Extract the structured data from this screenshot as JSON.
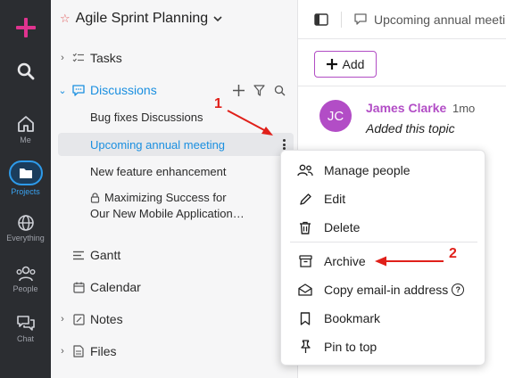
{
  "rail": {
    "items": [
      {
        "label": ""
      },
      {
        "label": ""
      },
      {
        "label": "Me"
      },
      {
        "label": "Projects"
      },
      {
        "label": "Everything"
      },
      {
        "label": "People"
      },
      {
        "label": "Chat"
      }
    ]
  },
  "sidebar": {
    "workspace_title": "Agile Sprint Planning",
    "tree": {
      "tasks": "Tasks",
      "discussions": "Discussions",
      "discussion_items": [
        "Bug fixes Discussions",
        "Upcoming annual meeting",
        "New feature enhancement",
        "Maximizing Success for",
        "Our New Mobile Application…"
      ],
      "gantt": "Gantt",
      "calendar": "Calendar",
      "notes": "Notes",
      "files": "Files"
    }
  },
  "main": {
    "tab_title": "Upcoming annual meeti",
    "add_label": "Add",
    "comment": {
      "avatar_initials": "JC",
      "author": "James Clarke",
      "time": "1mo",
      "text": "Added this topic"
    }
  },
  "context_menu": {
    "items": [
      "Manage people",
      "Edit",
      "Delete",
      "Archive",
      "Copy email-in address",
      "Bookmark",
      "Pin to top"
    ]
  },
  "annotations": {
    "step1": "1",
    "step2": "2"
  },
  "colors": {
    "accent_blue": "#1a8fe0",
    "brand_purple": "#b24dc6",
    "rail_bg": "#2b2d31",
    "annotation_red": "#e0201a",
    "add_plus": "#e0338f"
  }
}
